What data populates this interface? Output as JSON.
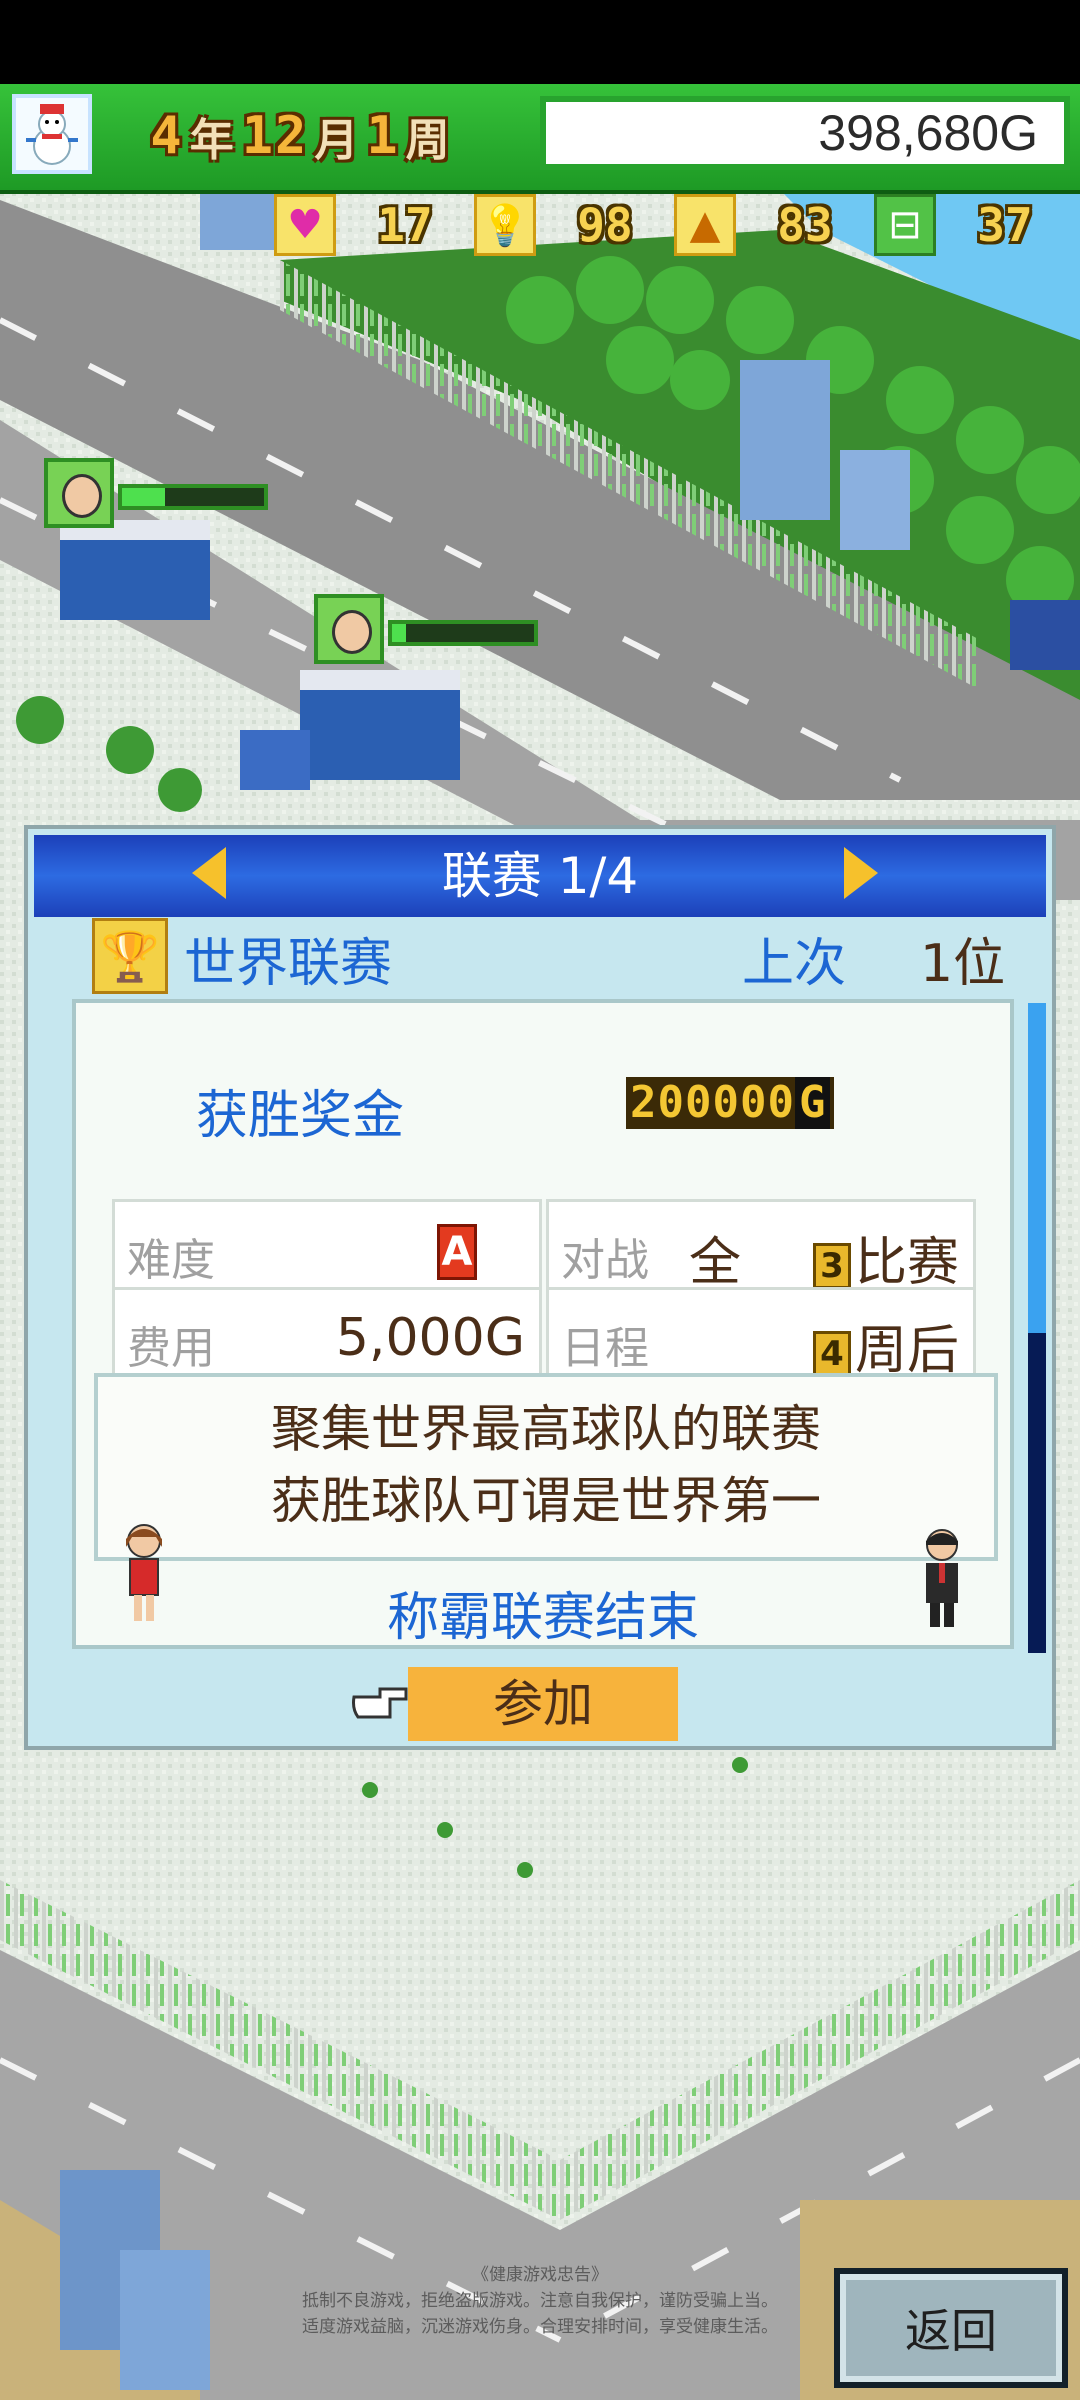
{
  "hud": {
    "year": "4",
    "year_unit": "年",
    "month": "12",
    "month_unit": "月",
    "week": "1",
    "week_unit": "周",
    "money": "398,680G"
  },
  "stats": [
    {
      "icon": "heart-icon",
      "value": "17"
    },
    {
      "icon": "lightbulb-icon",
      "value": "98"
    },
    {
      "icon": "cone-icon",
      "value": "83"
    },
    {
      "icon": "field-icon",
      "value": "37"
    }
  ],
  "dialog": {
    "title": "联赛 1/4",
    "league_name": "世界联赛",
    "last_label": "上次",
    "last_value": "1位",
    "prize_label": "获胜奖金",
    "prize_value": "200000",
    "prize_unit": "G",
    "difficulty_label": "难度",
    "difficulty_value": "A",
    "match_label": "对战",
    "match_value": "全",
    "match_count": "3",
    "match_unit": "比赛",
    "fee_label": "费用",
    "fee_value": "5,000G",
    "schedule_label": "日程",
    "schedule_count": "4",
    "schedule_unit": "周后",
    "desc_line1": "聚集世界最高球队的联赛",
    "desc_line2": "获胜球队可谓是世界第一",
    "finish_text": "称霸联赛结束",
    "join_label": "参加"
  },
  "footer": {
    "notice_title": "《健康游戏忠告》",
    "notice_line1": "抵制不良游戏，拒绝盗版游戏。注意自我保护，谨防受骗上当。",
    "notice_line2": "适度游戏益脑，沉迷游戏伤身。合理安排时间，享受健康生活。",
    "back_label": "返回"
  },
  "colors": {
    "hud_green": "#1e9a25",
    "dialog_blue": "#1c40b9",
    "label_blue": "#1c66d3",
    "join_orange": "#f7b33c"
  }
}
